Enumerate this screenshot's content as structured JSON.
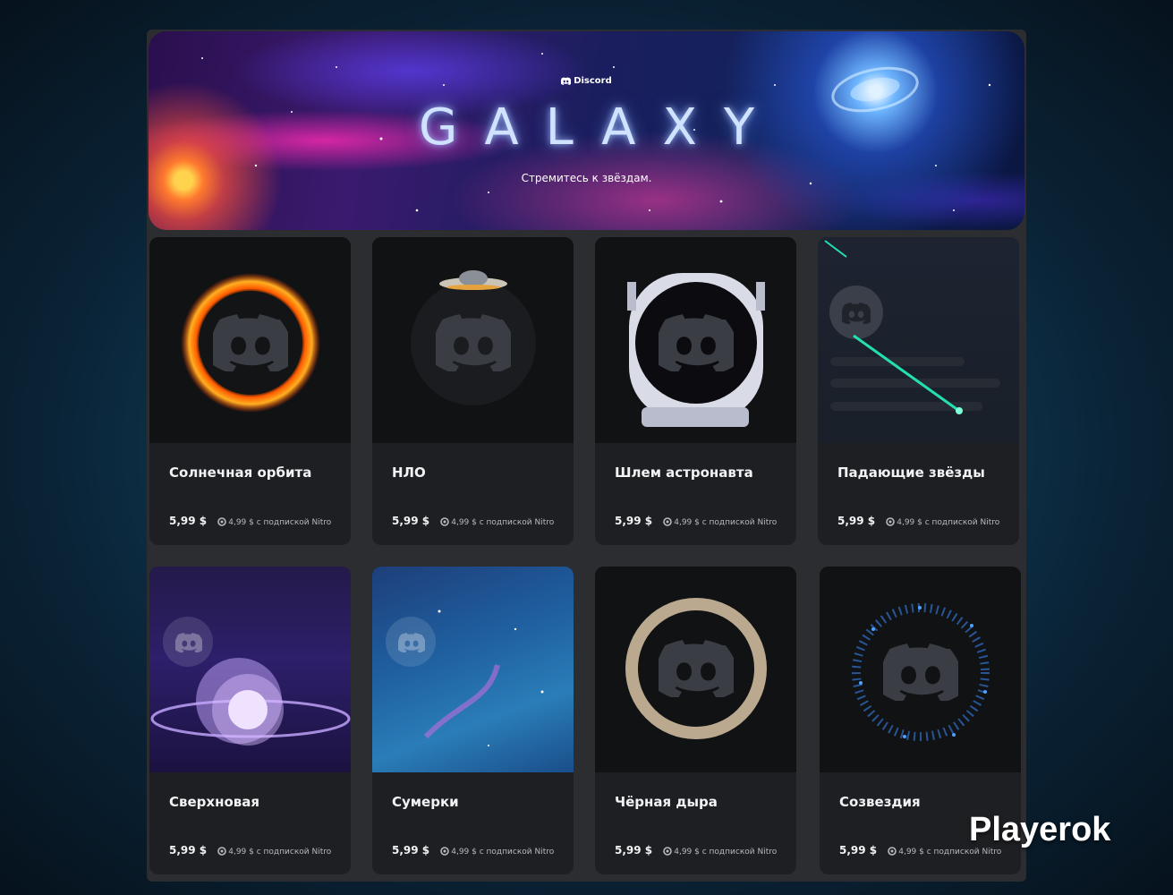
{
  "banner": {
    "brand": "Discord",
    "title": "GALAXY",
    "tagline": "Стремитесь к звёздам."
  },
  "items": [
    {
      "name": "Солнечная орбита",
      "price": "5,99 $",
      "nitro_price": "4,99 $ с подпиской Nitro"
    },
    {
      "name": "НЛО",
      "price": "5,99 $",
      "nitro_price": "4,99 $ с подпиской Nitro"
    },
    {
      "name": "Шлем астронавта",
      "price": "5,99 $",
      "nitro_price": "4,99 $ с подпиской Nitro"
    },
    {
      "name": "Падающие звёзды",
      "price": "5,99 $",
      "nitro_price": "4,99 $ с подпиской Nitro"
    },
    {
      "name": "Сверхновая",
      "price": "5,99 $",
      "nitro_price": "4,99 $ с подпиской Nitro"
    },
    {
      "name": "Сумерки",
      "price": "5,99 $",
      "nitro_price": "4,99 $ с подпиской Nitro"
    },
    {
      "name": "Чёрная дыра",
      "price": "5,99 $",
      "nitro_price": "4,99 $ с подпиской Nitro"
    },
    {
      "name": "Созвездия",
      "price": "5,99 $",
      "nitro_price": "4,99 $ с подпиской Nitro"
    }
  ],
  "watermark": "Playerok",
  "colors": {
    "panel": "#2b2d31",
    "card": "#1e1f22",
    "text": "#f2f3f5",
    "muted": "#b5bac1"
  }
}
